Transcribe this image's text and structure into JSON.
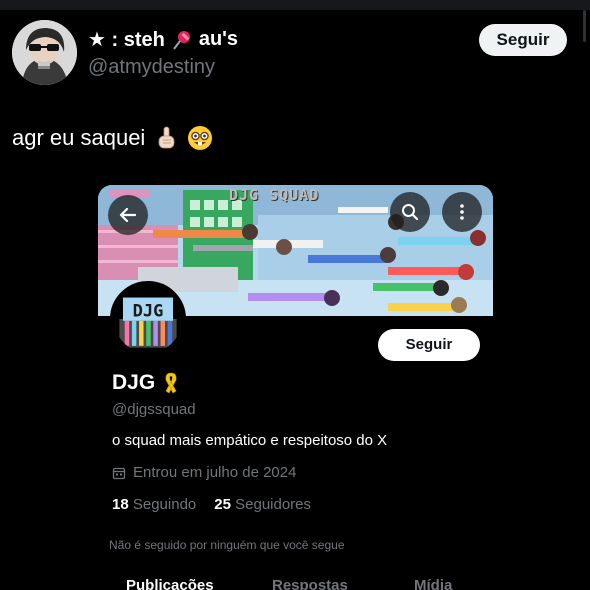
{
  "tweet": {
    "display_name_prefix": "★ : steh",
    "display_name_suffix": "au's",
    "username": "@atmydestiny",
    "follow_label": "Seguir",
    "text": "agr eu saquei"
  },
  "profile_card": {
    "banner_title": "DJG SQUAD",
    "name": "DJG",
    "handle": "@djgssquad",
    "bio": "o squad mais empático e respeitoso do X",
    "joined": "Entrou em julho de 2024",
    "following_count": "18",
    "following_label": "Seguindo",
    "followers_count": "25",
    "followers_label": "Seguidores",
    "follow_label": "Seguir",
    "not_followed_note": "Não é seguido por ninguém que você segue",
    "tabs": [
      "Publicações",
      "Respostas",
      "Mídia"
    ]
  },
  "icons": {
    "back": "arrow-left-icon",
    "search": "search-icon",
    "more": "more-vertical-icon",
    "calendar": "calendar-icon",
    "ribbon": "yellow-ribbon-icon",
    "pin": "pushpin-icon"
  },
  "colors": {
    "background": "#000000",
    "text_primary": "#e7e9ea",
    "text_secondary": "#71767b",
    "button_bg": "#eff3f4"
  }
}
